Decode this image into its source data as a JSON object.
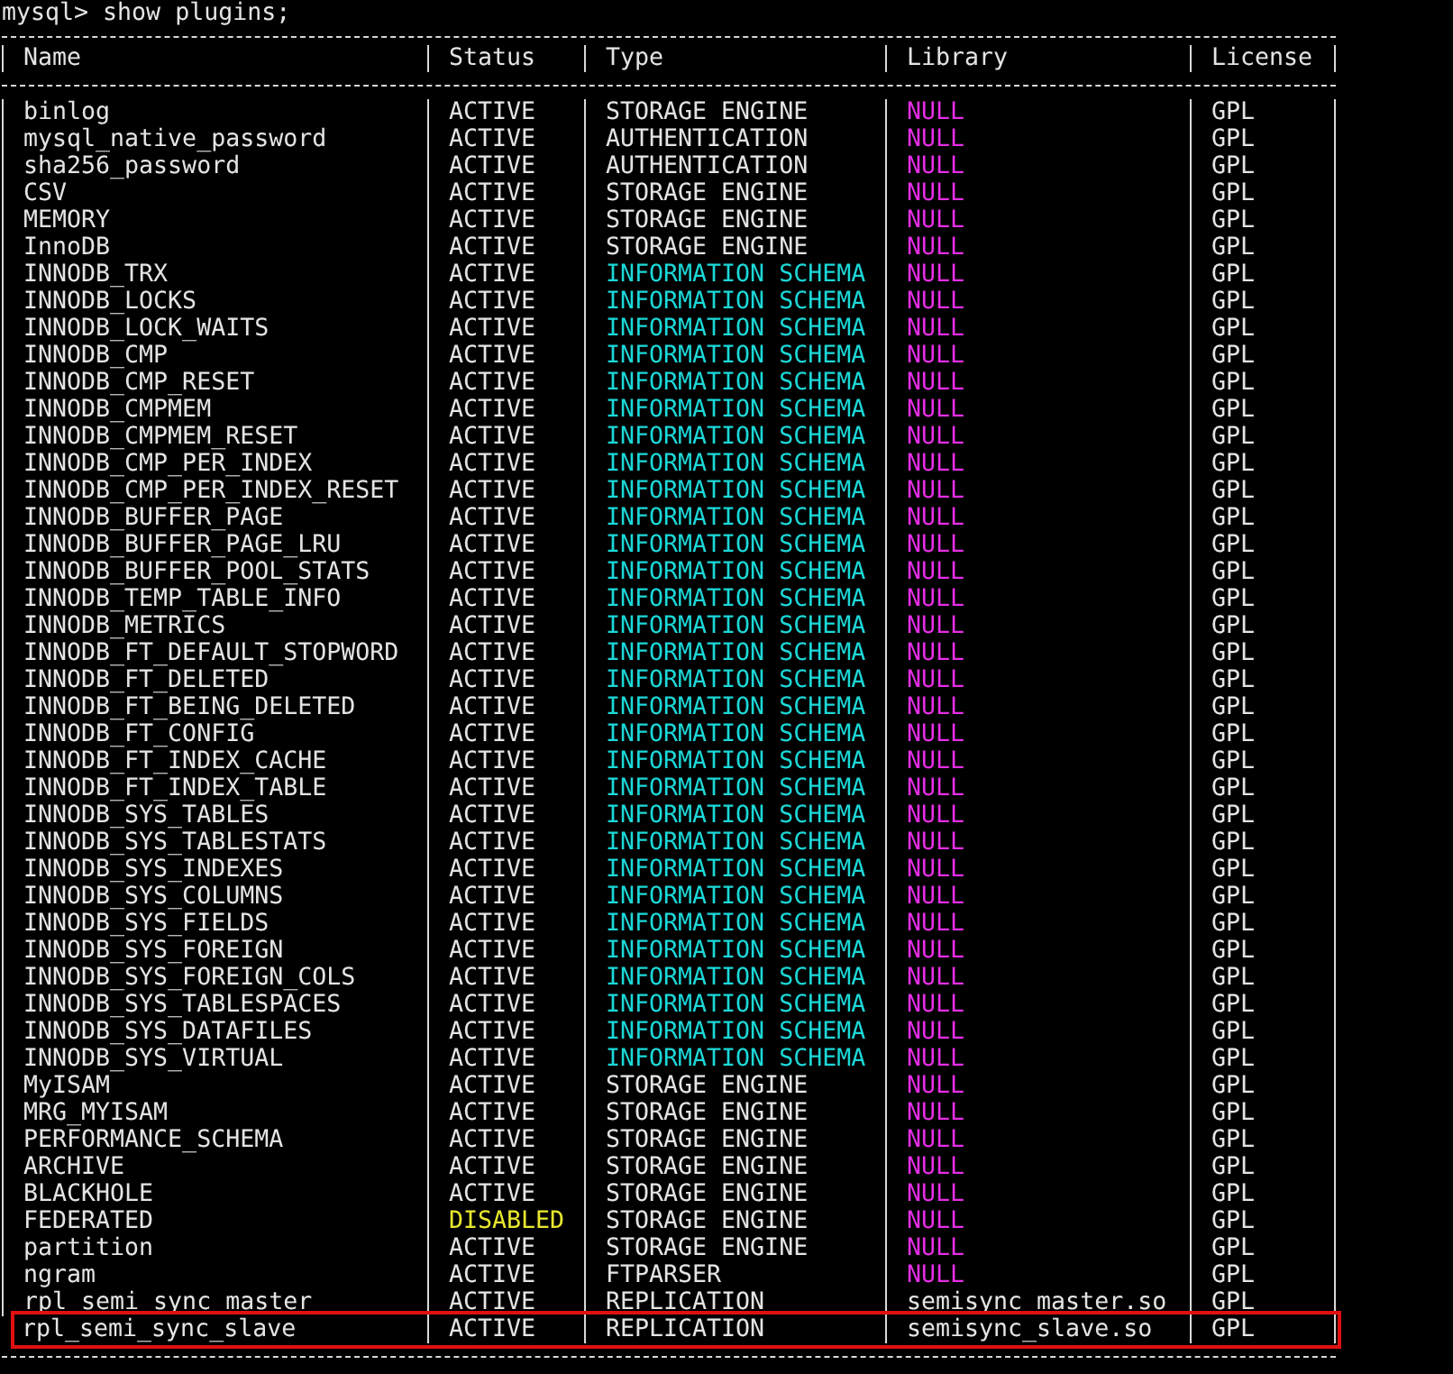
{
  "prompt": "mysql> show plugins;",
  "table": {
    "columns": [
      "Name",
      "Status",
      "Type",
      "Library",
      "License"
    ],
    "rows": [
      {
        "highlighted": false,
        "cells": [
          {
            "text": "binlog"
          },
          {
            "text": "ACTIVE"
          },
          {
            "text": "STORAGE ENGINE"
          },
          {
            "text": "NULL",
            "color": "#e62ee6"
          },
          {
            "text": "GPL"
          }
        ]
      },
      {
        "highlighted": false,
        "cells": [
          {
            "text": "mysql_native_password"
          },
          {
            "text": "ACTIVE"
          },
          {
            "text": "AUTHENTICATION"
          },
          {
            "text": "NULL",
            "color": "#e62ee6"
          },
          {
            "text": "GPL"
          }
        ]
      },
      {
        "highlighted": false,
        "cells": [
          {
            "text": "sha256_password"
          },
          {
            "text": "ACTIVE"
          },
          {
            "text": "AUTHENTICATION"
          },
          {
            "text": "NULL",
            "color": "#e62ee6"
          },
          {
            "text": "GPL"
          }
        ]
      },
      {
        "highlighted": false,
        "cells": [
          {
            "text": "CSV"
          },
          {
            "text": "ACTIVE"
          },
          {
            "text": "STORAGE ENGINE"
          },
          {
            "text": "NULL",
            "color": "#e62ee6"
          },
          {
            "text": "GPL"
          }
        ]
      },
      {
        "highlighted": false,
        "cells": [
          {
            "text": "MEMORY"
          },
          {
            "text": "ACTIVE"
          },
          {
            "text": "STORAGE ENGINE"
          },
          {
            "text": "NULL",
            "color": "#e62ee6"
          },
          {
            "text": "GPL"
          }
        ]
      },
      {
        "highlighted": false,
        "cells": [
          {
            "text": "InnoDB"
          },
          {
            "text": "ACTIVE"
          },
          {
            "text": "STORAGE ENGINE"
          },
          {
            "text": "NULL",
            "color": "#e62ee6"
          },
          {
            "text": "GPL"
          }
        ]
      },
      {
        "highlighted": false,
        "cells": [
          {
            "text": "INNODB_TRX"
          },
          {
            "text": "ACTIVE"
          },
          {
            "text": "INFORMATION SCHEMA",
            "color": "#1cd8d8"
          },
          {
            "text": "NULL",
            "color": "#e62ee6"
          },
          {
            "text": "GPL"
          }
        ]
      },
      {
        "highlighted": false,
        "cells": [
          {
            "text": "INNODB_LOCKS"
          },
          {
            "text": "ACTIVE"
          },
          {
            "text": "INFORMATION SCHEMA",
            "color": "#1cd8d8"
          },
          {
            "text": "NULL",
            "color": "#e62ee6"
          },
          {
            "text": "GPL"
          }
        ]
      },
      {
        "highlighted": false,
        "cells": [
          {
            "text": "INNODB_LOCK_WAITS"
          },
          {
            "text": "ACTIVE"
          },
          {
            "text": "INFORMATION SCHEMA",
            "color": "#1cd8d8"
          },
          {
            "text": "NULL",
            "color": "#e62ee6"
          },
          {
            "text": "GPL"
          }
        ]
      },
      {
        "highlighted": false,
        "cells": [
          {
            "text": "INNODB_CMP"
          },
          {
            "text": "ACTIVE"
          },
          {
            "text": "INFORMATION SCHEMA",
            "color": "#1cd8d8"
          },
          {
            "text": "NULL",
            "color": "#e62ee6"
          },
          {
            "text": "GPL"
          }
        ]
      },
      {
        "highlighted": false,
        "cells": [
          {
            "text": "INNODB_CMP_RESET"
          },
          {
            "text": "ACTIVE"
          },
          {
            "text": "INFORMATION SCHEMA",
            "color": "#1cd8d8"
          },
          {
            "text": "NULL",
            "color": "#e62ee6"
          },
          {
            "text": "GPL"
          }
        ]
      },
      {
        "highlighted": false,
        "cells": [
          {
            "text": "INNODB_CMPMEM"
          },
          {
            "text": "ACTIVE"
          },
          {
            "text": "INFORMATION SCHEMA",
            "color": "#1cd8d8"
          },
          {
            "text": "NULL",
            "color": "#e62ee6"
          },
          {
            "text": "GPL"
          }
        ]
      },
      {
        "highlighted": false,
        "cells": [
          {
            "text": "INNODB_CMPMEM_RESET"
          },
          {
            "text": "ACTIVE"
          },
          {
            "text": "INFORMATION SCHEMA",
            "color": "#1cd8d8"
          },
          {
            "text": "NULL",
            "color": "#e62ee6"
          },
          {
            "text": "GPL"
          }
        ]
      },
      {
        "highlighted": false,
        "cells": [
          {
            "text": "INNODB_CMP_PER_INDEX"
          },
          {
            "text": "ACTIVE"
          },
          {
            "text": "INFORMATION SCHEMA",
            "color": "#1cd8d8"
          },
          {
            "text": "NULL",
            "color": "#e62ee6"
          },
          {
            "text": "GPL"
          }
        ]
      },
      {
        "highlighted": false,
        "cells": [
          {
            "text": "INNODB_CMP_PER_INDEX_RESET"
          },
          {
            "text": "ACTIVE"
          },
          {
            "text": "INFORMATION SCHEMA",
            "color": "#1cd8d8"
          },
          {
            "text": "NULL",
            "color": "#e62ee6"
          },
          {
            "text": "GPL"
          }
        ]
      },
      {
        "highlighted": false,
        "cells": [
          {
            "text": "INNODB_BUFFER_PAGE"
          },
          {
            "text": "ACTIVE"
          },
          {
            "text": "INFORMATION SCHEMA",
            "color": "#1cd8d8"
          },
          {
            "text": "NULL",
            "color": "#e62ee6"
          },
          {
            "text": "GPL"
          }
        ]
      },
      {
        "highlighted": false,
        "cells": [
          {
            "text": "INNODB_BUFFER_PAGE_LRU"
          },
          {
            "text": "ACTIVE"
          },
          {
            "text": "INFORMATION SCHEMA",
            "color": "#1cd8d8"
          },
          {
            "text": "NULL",
            "color": "#e62ee6"
          },
          {
            "text": "GPL"
          }
        ]
      },
      {
        "highlighted": false,
        "cells": [
          {
            "text": "INNODB_BUFFER_POOL_STATS"
          },
          {
            "text": "ACTIVE"
          },
          {
            "text": "INFORMATION SCHEMA",
            "color": "#1cd8d8"
          },
          {
            "text": "NULL",
            "color": "#e62ee6"
          },
          {
            "text": "GPL"
          }
        ]
      },
      {
        "highlighted": false,
        "cells": [
          {
            "text": "INNODB_TEMP_TABLE_INFO"
          },
          {
            "text": "ACTIVE"
          },
          {
            "text": "INFORMATION SCHEMA",
            "color": "#1cd8d8"
          },
          {
            "text": "NULL",
            "color": "#e62ee6"
          },
          {
            "text": "GPL"
          }
        ]
      },
      {
        "highlighted": false,
        "cells": [
          {
            "text": "INNODB_METRICS"
          },
          {
            "text": "ACTIVE"
          },
          {
            "text": "INFORMATION SCHEMA",
            "color": "#1cd8d8"
          },
          {
            "text": "NULL",
            "color": "#e62ee6"
          },
          {
            "text": "GPL"
          }
        ]
      },
      {
        "highlighted": false,
        "cells": [
          {
            "text": "INNODB_FT_DEFAULT_STOPWORD"
          },
          {
            "text": "ACTIVE"
          },
          {
            "text": "INFORMATION SCHEMA",
            "color": "#1cd8d8"
          },
          {
            "text": "NULL",
            "color": "#e62ee6"
          },
          {
            "text": "GPL"
          }
        ]
      },
      {
        "highlighted": false,
        "cells": [
          {
            "text": "INNODB_FT_DELETED"
          },
          {
            "text": "ACTIVE"
          },
          {
            "text": "INFORMATION SCHEMA",
            "color": "#1cd8d8"
          },
          {
            "text": "NULL",
            "color": "#e62ee6"
          },
          {
            "text": "GPL"
          }
        ]
      },
      {
        "highlighted": false,
        "cells": [
          {
            "text": "INNODB_FT_BEING_DELETED"
          },
          {
            "text": "ACTIVE"
          },
          {
            "text": "INFORMATION SCHEMA",
            "color": "#1cd8d8"
          },
          {
            "text": "NULL",
            "color": "#e62ee6"
          },
          {
            "text": "GPL"
          }
        ]
      },
      {
        "highlighted": false,
        "cells": [
          {
            "text": "INNODB_FT_CONFIG"
          },
          {
            "text": "ACTIVE"
          },
          {
            "text": "INFORMATION SCHEMA",
            "color": "#1cd8d8"
          },
          {
            "text": "NULL",
            "color": "#e62ee6"
          },
          {
            "text": "GPL"
          }
        ]
      },
      {
        "highlighted": false,
        "cells": [
          {
            "text": "INNODB_FT_INDEX_CACHE"
          },
          {
            "text": "ACTIVE"
          },
          {
            "text": "INFORMATION SCHEMA",
            "color": "#1cd8d8"
          },
          {
            "text": "NULL",
            "color": "#e62ee6"
          },
          {
            "text": "GPL"
          }
        ]
      },
      {
        "highlighted": false,
        "cells": [
          {
            "text": "INNODB_FT_INDEX_TABLE"
          },
          {
            "text": "ACTIVE"
          },
          {
            "text": "INFORMATION SCHEMA",
            "color": "#1cd8d8"
          },
          {
            "text": "NULL",
            "color": "#e62ee6"
          },
          {
            "text": "GPL"
          }
        ]
      },
      {
        "highlighted": false,
        "cells": [
          {
            "text": "INNODB_SYS_TABLES"
          },
          {
            "text": "ACTIVE"
          },
          {
            "text": "INFORMATION SCHEMA",
            "color": "#1cd8d8"
          },
          {
            "text": "NULL",
            "color": "#e62ee6"
          },
          {
            "text": "GPL"
          }
        ]
      },
      {
        "highlighted": false,
        "cells": [
          {
            "text": "INNODB_SYS_TABLESTATS"
          },
          {
            "text": "ACTIVE"
          },
          {
            "text": "INFORMATION SCHEMA",
            "color": "#1cd8d8"
          },
          {
            "text": "NULL",
            "color": "#e62ee6"
          },
          {
            "text": "GPL"
          }
        ]
      },
      {
        "highlighted": false,
        "cells": [
          {
            "text": "INNODB_SYS_INDEXES"
          },
          {
            "text": "ACTIVE"
          },
          {
            "text": "INFORMATION SCHEMA",
            "color": "#1cd8d8"
          },
          {
            "text": "NULL",
            "color": "#e62ee6"
          },
          {
            "text": "GPL"
          }
        ]
      },
      {
        "highlighted": false,
        "cells": [
          {
            "text": "INNODB_SYS_COLUMNS"
          },
          {
            "text": "ACTIVE"
          },
          {
            "text": "INFORMATION SCHEMA",
            "color": "#1cd8d8"
          },
          {
            "text": "NULL",
            "color": "#e62ee6"
          },
          {
            "text": "GPL"
          }
        ]
      },
      {
        "highlighted": false,
        "cells": [
          {
            "text": "INNODB_SYS_FIELDS"
          },
          {
            "text": "ACTIVE"
          },
          {
            "text": "INFORMATION SCHEMA",
            "color": "#1cd8d8"
          },
          {
            "text": "NULL",
            "color": "#e62ee6"
          },
          {
            "text": "GPL"
          }
        ]
      },
      {
        "highlighted": false,
        "cells": [
          {
            "text": "INNODB_SYS_FOREIGN"
          },
          {
            "text": "ACTIVE"
          },
          {
            "text": "INFORMATION SCHEMA",
            "color": "#1cd8d8"
          },
          {
            "text": "NULL",
            "color": "#e62ee6"
          },
          {
            "text": "GPL"
          }
        ]
      },
      {
        "highlighted": false,
        "cells": [
          {
            "text": "INNODB_SYS_FOREIGN_COLS"
          },
          {
            "text": "ACTIVE"
          },
          {
            "text": "INFORMATION SCHEMA",
            "color": "#1cd8d8"
          },
          {
            "text": "NULL",
            "color": "#e62ee6"
          },
          {
            "text": "GPL"
          }
        ]
      },
      {
        "highlighted": false,
        "cells": [
          {
            "text": "INNODB_SYS_TABLESPACES"
          },
          {
            "text": "ACTIVE"
          },
          {
            "text": "INFORMATION SCHEMA",
            "color": "#1cd8d8"
          },
          {
            "text": "NULL",
            "color": "#e62ee6"
          },
          {
            "text": "GPL"
          }
        ]
      },
      {
        "highlighted": false,
        "cells": [
          {
            "text": "INNODB_SYS_DATAFILES"
          },
          {
            "text": "ACTIVE"
          },
          {
            "text": "INFORMATION SCHEMA",
            "color": "#1cd8d8"
          },
          {
            "text": "NULL",
            "color": "#e62ee6"
          },
          {
            "text": "GPL"
          }
        ]
      },
      {
        "highlighted": false,
        "cells": [
          {
            "text": "INNODB_SYS_VIRTUAL"
          },
          {
            "text": "ACTIVE"
          },
          {
            "text": "INFORMATION SCHEMA",
            "color": "#1cd8d8"
          },
          {
            "text": "NULL",
            "color": "#e62ee6"
          },
          {
            "text": "GPL"
          }
        ]
      },
      {
        "highlighted": false,
        "cells": [
          {
            "text": "MyISAM"
          },
          {
            "text": "ACTIVE"
          },
          {
            "text": "STORAGE ENGINE"
          },
          {
            "text": "NULL",
            "color": "#e62ee6"
          },
          {
            "text": "GPL"
          }
        ]
      },
      {
        "highlighted": false,
        "cells": [
          {
            "text": "MRG_MYISAM"
          },
          {
            "text": "ACTIVE"
          },
          {
            "text": "STORAGE ENGINE"
          },
          {
            "text": "NULL",
            "color": "#e62ee6"
          },
          {
            "text": "GPL"
          }
        ]
      },
      {
        "highlighted": false,
        "cells": [
          {
            "text": "PERFORMANCE_SCHEMA"
          },
          {
            "text": "ACTIVE"
          },
          {
            "text": "STORAGE ENGINE"
          },
          {
            "text": "NULL",
            "color": "#e62ee6"
          },
          {
            "text": "GPL"
          }
        ]
      },
      {
        "highlighted": false,
        "cells": [
          {
            "text": "ARCHIVE"
          },
          {
            "text": "ACTIVE"
          },
          {
            "text": "STORAGE ENGINE"
          },
          {
            "text": "NULL",
            "color": "#e62ee6"
          },
          {
            "text": "GPL"
          }
        ]
      },
      {
        "highlighted": false,
        "cells": [
          {
            "text": "BLACKHOLE"
          },
          {
            "text": "ACTIVE"
          },
          {
            "text": "STORAGE ENGINE"
          },
          {
            "text": "NULL",
            "color": "#e62ee6"
          },
          {
            "text": "GPL"
          }
        ]
      },
      {
        "highlighted": false,
        "cells": [
          {
            "text": "FEDERATED"
          },
          {
            "text": "DISABLED",
            "color": "#e8e830"
          },
          {
            "text": "STORAGE ENGINE"
          },
          {
            "text": "NULL",
            "color": "#e62ee6"
          },
          {
            "text": "GPL"
          }
        ]
      },
      {
        "highlighted": false,
        "cells": [
          {
            "text": "partition"
          },
          {
            "text": "ACTIVE"
          },
          {
            "text": "STORAGE ENGINE"
          },
          {
            "text": "NULL",
            "color": "#e62ee6"
          },
          {
            "text": "GPL"
          }
        ]
      },
      {
        "highlighted": false,
        "cells": [
          {
            "text": "ngram"
          },
          {
            "text": "ACTIVE"
          },
          {
            "text": "FTPARSER"
          },
          {
            "text": "NULL",
            "color": "#e62ee6"
          },
          {
            "text": "GPL"
          }
        ]
      },
      {
        "highlighted": false,
        "cells": [
          {
            "text": "rpl semi sync master"
          },
          {
            "text": "ACTIVE"
          },
          {
            "text": "REPLICATION"
          },
          {
            "text": "semisync master.so"
          },
          {
            "text": "GPL"
          }
        ]
      },
      {
        "highlighted": true,
        "cells": [
          {
            "text": "rpl_semi_sync_slave"
          },
          {
            "text": "ACTIVE"
          },
          {
            "text": "REPLICATION"
          },
          {
            "text": "semisync_slave.so"
          },
          {
            "text": "GPL"
          }
        ]
      }
    ]
  }
}
